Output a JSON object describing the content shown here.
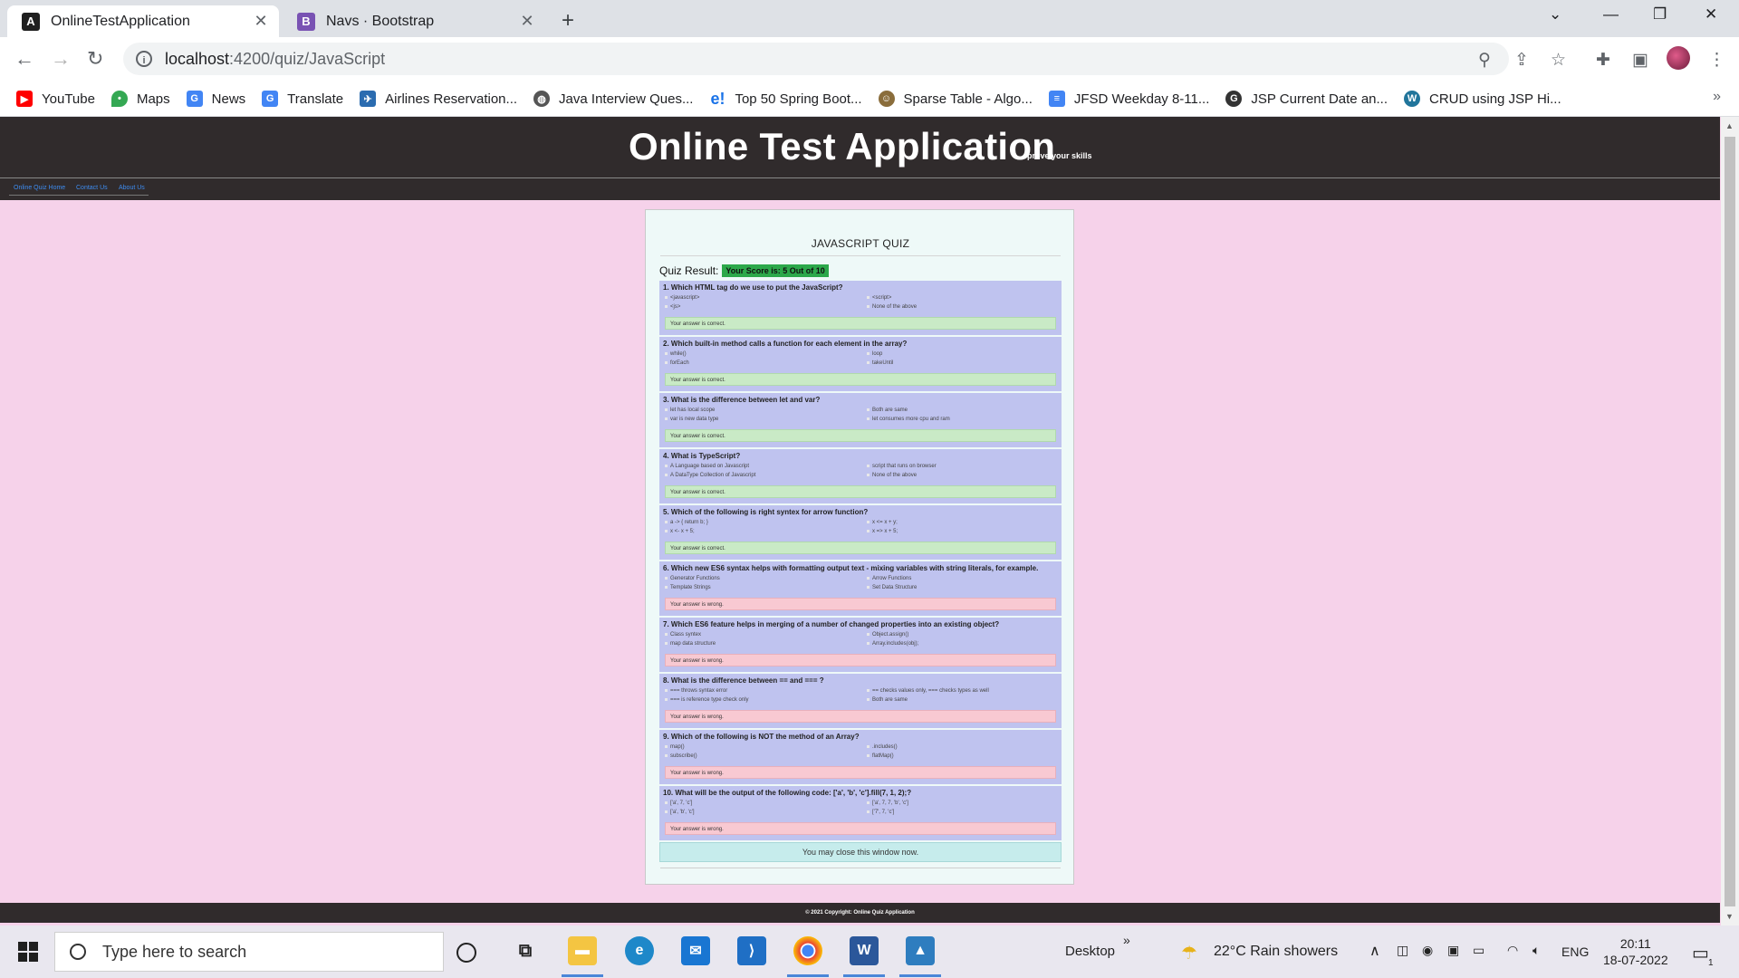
{
  "browser": {
    "tabs": [
      {
        "title": "OnlineTestApplication",
        "icon": "angular-icon",
        "active": true
      },
      {
        "title": "Navs · Bootstrap",
        "icon": "bootstrap-icon",
        "active": false
      }
    ],
    "url_host": "localhost",
    "url_path": ":4200/quiz/JavaScript",
    "bookmarks": [
      {
        "label": "YouTube",
        "icon": "youtube-icon",
        "color": "#ff0000"
      },
      {
        "label": "Maps",
        "icon": "maps-icon",
        "color": "#34a853"
      },
      {
        "label": "News",
        "icon": "news-icon",
        "color": "#4285f4"
      },
      {
        "label": "Translate",
        "icon": "translate-icon",
        "color": "#4285f4"
      },
      {
        "label": "Airlines Reservation...",
        "icon": "airlines-icon",
        "color": "#2b6cb0"
      },
      {
        "label": "Java Interview Ques...",
        "icon": "globe-icon",
        "color": "#555555"
      },
      {
        "label": "Top 50 Spring Boot...",
        "icon": "e-icon",
        "color": "#1a73e8"
      },
      {
        "label": "Sparse Table - Algo...",
        "icon": "algo-icon",
        "color": "#8a6d3b"
      },
      {
        "label": "JFSD Weekday 8-11...",
        "icon": "docs-icon",
        "color": "#4285f4"
      },
      {
        "label": "JSP Current Date an...",
        "icon": "g-icon",
        "color": "#333333"
      },
      {
        "label": "CRUD using JSP Hi...",
        "icon": "wordpress-icon",
        "color": "#21759b"
      }
    ]
  },
  "app": {
    "title": "Online Test Application",
    "tagline": "prove your skills",
    "nav": [
      "Online Quiz Home",
      "Contact Us",
      "About Us"
    ],
    "footer": "© 2021 Copyright: Online Quiz Application"
  },
  "quiz": {
    "heading": "JAVASCRIPT QUIZ",
    "result_label": "Quiz Result:",
    "score_text": "Your Score is: 5 Out of 10",
    "closing_text": "You may close this window now.",
    "questions": [
      {
        "text": "1. Which HTML tag do we use to put the JavaScript?",
        "options": [
          "<javascript>",
          "<script>",
          "<js>",
          "None of the above"
        ],
        "feedback": "Your answer is correct.",
        "correct": true
      },
      {
        "text": "2. Which built-in method calls a function for each element in the array?",
        "options": [
          "while()",
          "loop",
          "forEach",
          "takeUntil"
        ],
        "feedback": "Your answer is correct.",
        "correct": true
      },
      {
        "text": "3. What is the difference between let and var?",
        "options": [
          "let has local scope",
          "Both are same",
          "var is new data type",
          "let consumes more cpu and ram"
        ],
        "feedback": "Your answer is correct.",
        "correct": true
      },
      {
        "text": "4. What is TypeScript?",
        "options": [
          "A Language based on Javascript",
          "script that runs on browser",
          "A DataType Collection of Javascript",
          "None of the above"
        ],
        "feedback": "Your answer is correct.",
        "correct": true
      },
      {
        "text": "5. Which of the following is right syntex for arrow function?",
        "options": [
          "a -> { return b; }",
          "x <= x + y;",
          "x <- x + 5;",
          "x => x + 5;"
        ],
        "feedback": "Your answer is correct.",
        "correct": true
      },
      {
        "text": "6. Which new ES6 syntax helps with formatting output text - mixing variables with string literals, for example.",
        "options": [
          "Generator Functions",
          "Arrow Functions",
          "Template Strings",
          "Set Data Structure"
        ],
        "feedback": "Your answer is wrong.",
        "correct": false
      },
      {
        "text": "7. Which ES6 feature helps in merging of a number of changed properties into an existing object?",
        "options": [
          "Class syntex",
          "Object.assign()",
          "map data structure",
          "Array.includes(obj);"
        ],
        "feedback": "Your answer is wrong.",
        "correct": false
      },
      {
        "text": "8. What is the difference between == and === ?",
        "options": [
          "=== throws syntax error",
          "== checks values only, === checks types as well",
          "=== is reference type check only",
          "Both are same"
        ],
        "feedback": "Your answer is wrong.",
        "correct": false
      },
      {
        "text": "9. Which of the following is NOT the method of an Array?",
        "options": [
          "map()",
          ".includes()",
          "subscribe()",
          "flatMap()"
        ],
        "feedback": "Your answer is wrong.",
        "correct": false
      },
      {
        "text": "10. What will be the output of the following code: ['a', 'b', 'c'].fill(7, 1, 2);?",
        "options": [
          "['a', 7, 'c']",
          "['a', 7, 7, 'b', 'c']",
          "['a', 'b', 'c']",
          "['7', 7, 'c']"
        ],
        "feedback": "Your answer is wrong.",
        "correct": false
      }
    ]
  },
  "taskbar": {
    "search_placeholder": "Type here to search",
    "apps": [
      "cortana-icon",
      "task-view-icon",
      "file-explorer-icon",
      "edge-icon",
      "mail-icon",
      "vscode-icon",
      "chrome-icon",
      "word-icon",
      "photos-icon"
    ],
    "desktop_label": "Desktop",
    "weather": "22°C  Rain showers",
    "language": "ENG",
    "time": "20:11",
    "date": "18-07-2022",
    "notification_count": "1"
  },
  "colors": {
    "page_bg": "#f6d2ea",
    "header_bg": "#302b2c",
    "score_badge": "#2ca84a",
    "question_bg": "#bfc3ef",
    "correct_bg": "#c9eac6",
    "wrong_bg": "#f8c9d2"
  }
}
